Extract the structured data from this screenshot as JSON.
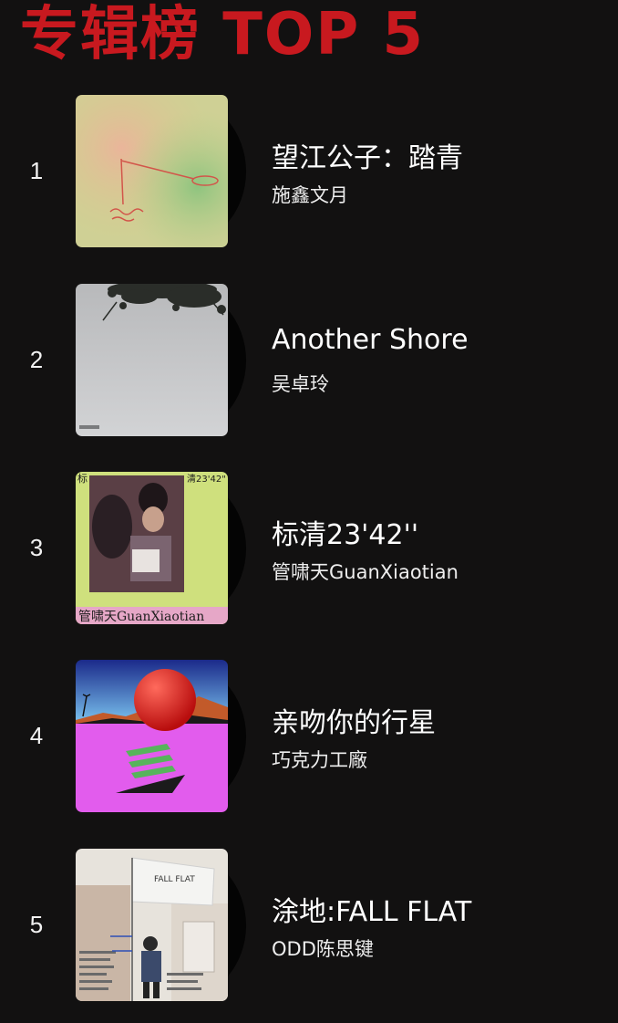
{
  "header": {
    "title": "专辑榜 TOP 5",
    "color": "#c8191f"
  },
  "albums": [
    {
      "rank": "1",
      "title": "望江公子：踏青",
      "artist": "施鑫文月",
      "cover_icon": "sketch-painting-cover"
    },
    {
      "rank": "2",
      "title": "Another Shore",
      "artist": "吴卓玲",
      "cover_icon": "tree-sky-cover"
    },
    {
      "rank": "3",
      "title": "标清23'42''",
      "artist": "管啸天GuanXiaotian",
      "cover_icon": "portrait-photo-cover",
      "cover_texts": [
        "标",
        "清23'42\"",
        "管啸天GuanXiaotian"
      ]
    },
    {
      "rank": "4",
      "title": "亲吻你的行星",
      "artist": "巧克力工廠",
      "cover_icon": "red-planet-cover"
    },
    {
      "rank": "5",
      "title": "涂地:FALL FLAT",
      "artist": "ODD陈思键",
      "cover_icon": "flag-wall-cover",
      "cover_texts": [
        "FALL FLAT"
      ]
    }
  ]
}
